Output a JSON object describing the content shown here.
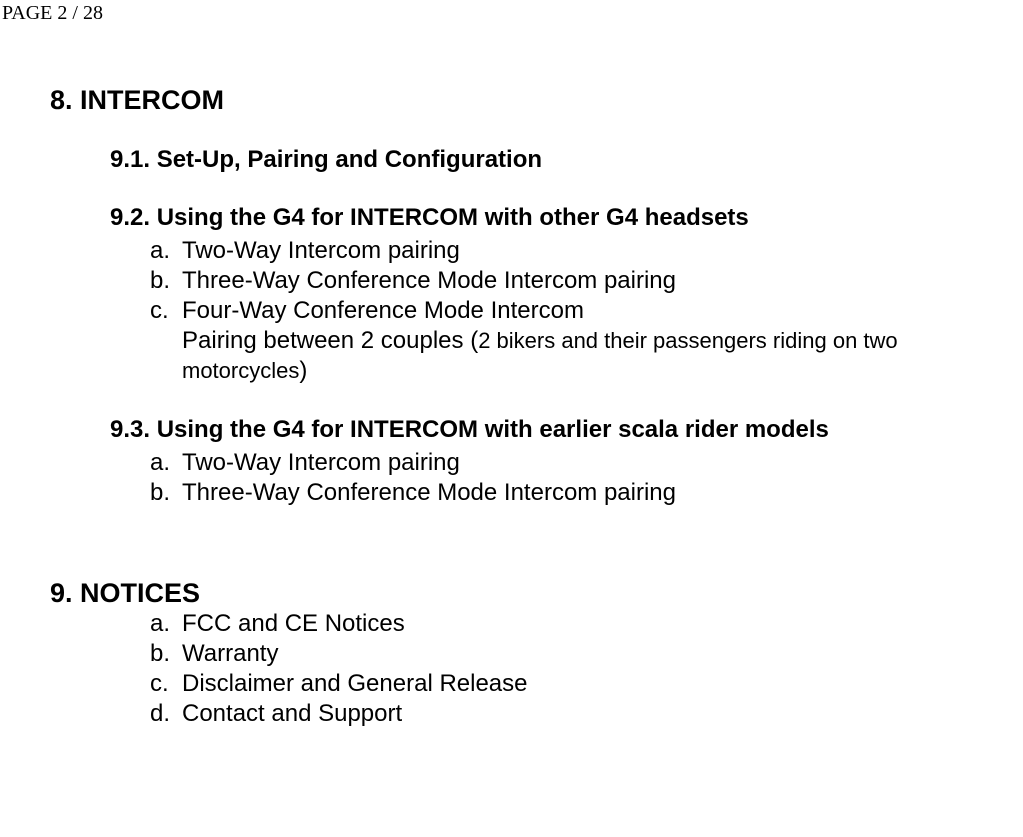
{
  "page_header": "PAGE 2 / 28",
  "section8": {
    "title": "8. INTERCOM",
    "s9_1": {
      "title": "9.1. Set-Up, Pairing and Configuration"
    },
    "s9_2": {
      "title": "9.2. Using the G4 for INTERCOM with other G4 headsets",
      "items": {
        "a": {
          "marker": "a.",
          "text": "Two-Way Intercom pairing"
        },
        "b": {
          "marker": "b.",
          "text": "Three-Way Conference Mode Intercom pairing"
        },
        "c": {
          "marker": "c.",
          "text": "Four-Way Conference Mode Intercom",
          "line2_prefix": "Pairing between 2 couples (",
          "line2_note": "2 bikers and their passengers riding on two motorcycles",
          "line2_suffix": ")"
        }
      }
    },
    "s9_3": {
      "title": "9.3. Using the G4 for INTERCOM with earlier scala rider models",
      "items": {
        "a": {
          "marker": "a.",
          "text": "Two-Way Intercom pairing"
        },
        "b": {
          "marker": "b.",
          "text": "Three-Way Conference Mode Intercom pairing"
        }
      }
    }
  },
  "section9": {
    "title": "9. NOTICES",
    "items": {
      "a": {
        "marker": "a.",
        "text": "FCC and CE Notices"
      },
      "b": {
        "marker": "b.",
        "text": "Warranty"
      },
      "c": {
        "marker": "c.",
        "text": "Disclaimer and General Release"
      },
      "d": {
        "marker": "d.",
        "text": "Contact and Support"
      }
    }
  }
}
